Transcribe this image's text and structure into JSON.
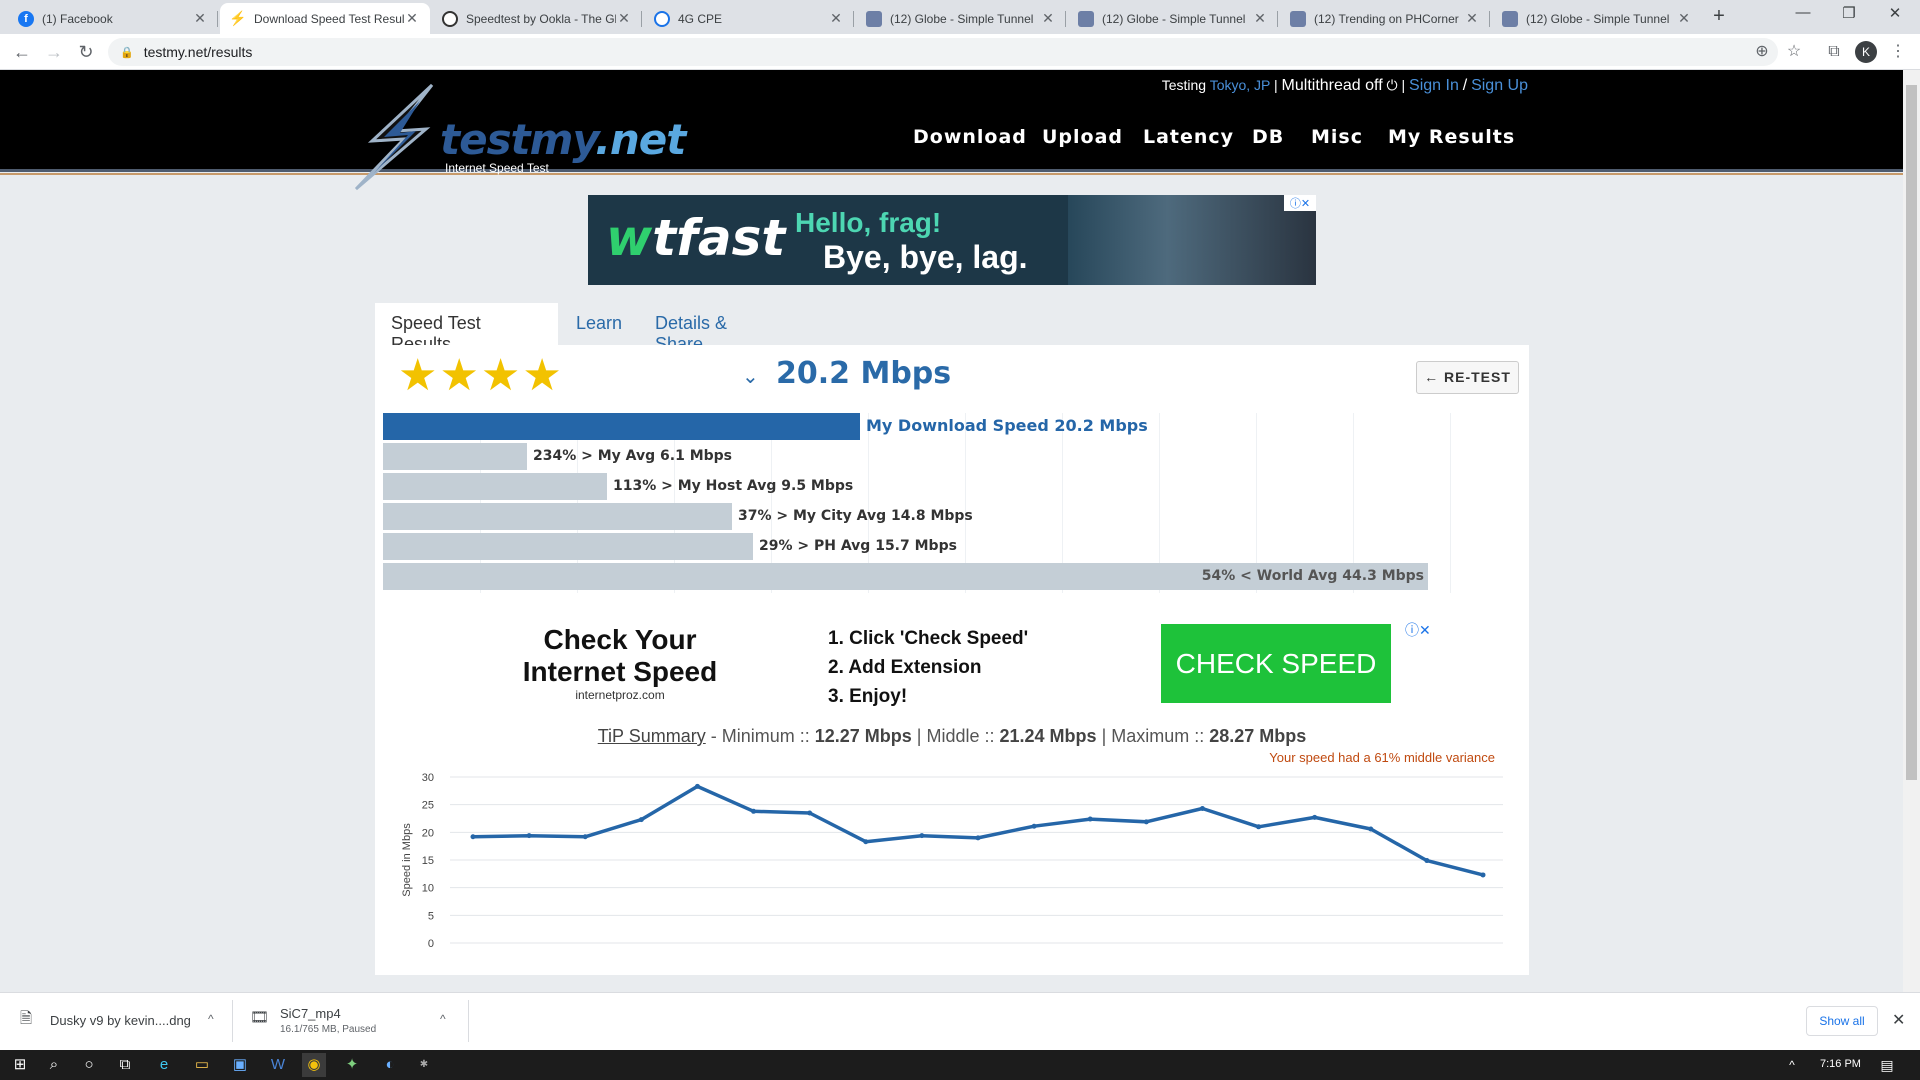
{
  "browser": {
    "tabs": [
      {
        "title": "(1) Facebook",
        "icon": "facebook-icon"
      },
      {
        "title": "Download Speed Test Results",
        "icon": "testmy-icon"
      },
      {
        "title": "Speedtest by Ookla - The Global",
        "icon": "ookla-icon"
      },
      {
        "title": "4G CPE",
        "icon": "globe-icon"
      },
      {
        "title": "(12) Globe - Simple Tunnel",
        "icon": "phcorner-icon"
      },
      {
        "title": "(12) Globe - Simple Tunnel",
        "icon": "phcorner-icon"
      },
      {
        "title": "(12) Trending on PHCorner",
        "icon": "phcorner-icon"
      },
      {
        "title": "(12) Globe - Simple Tunnel",
        "icon": "phcorner-icon"
      }
    ],
    "active_tab_index": 1,
    "url": "testmy.net/results",
    "profile_initial": "K"
  },
  "site": {
    "top_bar": {
      "testing_label": "Testing",
      "location": "Tokyo, JP",
      "separator": "|",
      "multithread": "Multithread off",
      "sign_in": "Sign In",
      "slash": "/",
      "sign_up": "Sign Up"
    },
    "logo": {
      "word_a": "testmy",
      "word_b": ".net",
      "tagline": "Internet Speed Test"
    },
    "menu": [
      "Download",
      "Upload",
      "Latency",
      "DB",
      "Misc",
      "My Results"
    ]
  },
  "banner_ad": {
    "brand": "tfast",
    "line1": "Hello, frag!",
    "line2": "Bye, bye, lag."
  },
  "tabs": [
    "Speed Test Results",
    "Learn",
    "Details & Share"
  ],
  "result": {
    "stars": "★★★★",
    "rating": 4,
    "speed": "20.2 Mbps",
    "retest_label": "← RE-TEST"
  },
  "comparison": [
    {
      "label": "My Download Speed 20.2 Mbps",
      "value": 20.2,
      "primary": true
    },
    {
      "label": "234% > My Avg 6.1 Mbps",
      "value": 6.1
    },
    {
      "label": "113% > My Host Avg 9.5 Mbps",
      "value": 9.5
    },
    {
      "label": "37% > My City Avg 14.8 Mbps",
      "value": 14.8
    },
    {
      "label": "29% > PH Avg 15.7 Mbps",
      "value": 15.7
    },
    {
      "label": "54% < World Avg 44.3 Mbps",
      "value": 44.3,
      "label_inside": true
    }
  ],
  "inline_ad": {
    "headline_1": "Check Your",
    "headline_2": "Internet Speed",
    "source": "internetproz.com",
    "step_1": "1. Click 'Check Speed'",
    "step_2": "2. Add Extension",
    "step_3": "3. Enjoy!",
    "button": "CHECK SPEED"
  },
  "tip_summary": {
    "title": "TiP Summary",
    "min_label": " - Minimum :: ",
    "min": "12.27 Mbps",
    "mid_label": " | Middle :: ",
    "mid": "21.24 Mbps",
    "max_label": " | Maximum :: ",
    "max": "28.27 Mbps",
    "variance": "Your speed had a 61% middle variance"
  },
  "chart_data": {
    "type": "line",
    "title": "",
    "xlabel": "",
    "ylabel": "Speed in Mbps",
    "ylim": [
      0,
      30
    ],
    "yticks": [
      0,
      5,
      10,
      15,
      20,
      25,
      30
    ],
    "grid": true,
    "series": [
      {
        "values": [
          19.2,
          19.4,
          19.2,
          22.3,
          28.3,
          23.8,
          23.5,
          18.3,
          19.4,
          19.0,
          21.1,
          22.4,
          21.9,
          24.3,
          21.0,
          22.7,
          20.6,
          14.9,
          12.3
        ],
        "color": "#2566a8"
      }
    ]
  },
  "downloads": [
    {
      "name": "Dusky v9 by kevin....dng",
      "status": "",
      "icon": "file-icon"
    },
    {
      "name": "SiC7_mp4",
      "status": "16.1/765 MB, Paused",
      "icon": "video-file-icon"
    }
  ],
  "show_all": "Show all",
  "clock": "7:16 PM"
}
